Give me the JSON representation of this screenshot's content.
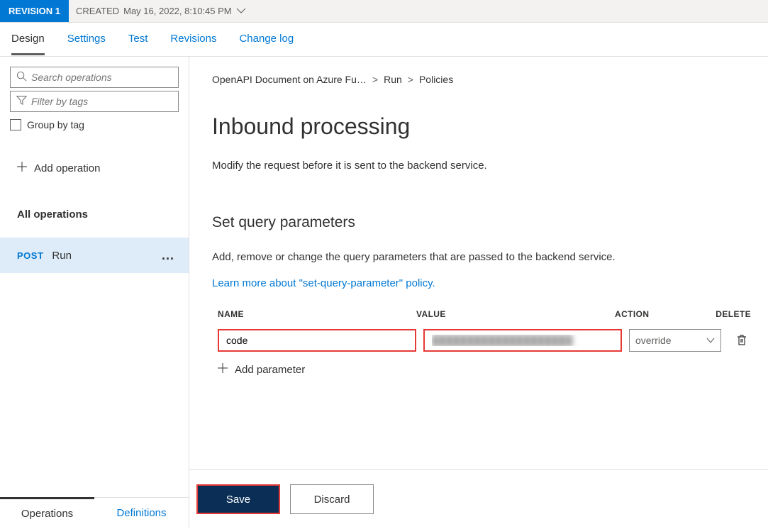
{
  "revision": {
    "label": "REVISION 1",
    "created_prefix": "CREATED",
    "created": "May 16, 2022, 8:10:45 PM"
  },
  "tabs": {
    "design": "Design",
    "settings": "Settings",
    "test": "Test",
    "revisions": "Revisions",
    "changelog": "Change log"
  },
  "sidebar": {
    "search_placeholder": "Search operations",
    "filter_placeholder": "Filter by tags",
    "group_by_tag": "Group by tag",
    "add_operation": "Add operation",
    "all_operations": "All operations",
    "operation": {
      "method": "POST",
      "name": "Run",
      "menu": "..."
    },
    "bottom_tabs": {
      "operations": "Operations",
      "definitions": "Definitions"
    }
  },
  "breadcrumb": {
    "api": "OpenAPI Document on Azure Fu…",
    "op": "Run",
    "page": "Policies",
    "sep": ">"
  },
  "page": {
    "title": "Inbound processing",
    "desc": "Modify the request before it is sent to the backend service."
  },
  "section": {
    "title": "Set query parameters",
    "desc": "Add, remove or change the query parameters that are passed to the backend service.",
    "learn": "Learn more about \"set-query-parameter\" policy."
  },
  "table": {
    "headers": {
      "name": "NAME",
      "value": "VALUE",
      "action": "ACTION",
      "delete": "DELETE"
    },
    "row": {
      "name": "code",
      "value": "████████████████████",
      "action": "override"
    },
    "add": "Add parameter"
  },
  "footer": {
    "save": "Save",
    "discard": "Discard"
  }
}
